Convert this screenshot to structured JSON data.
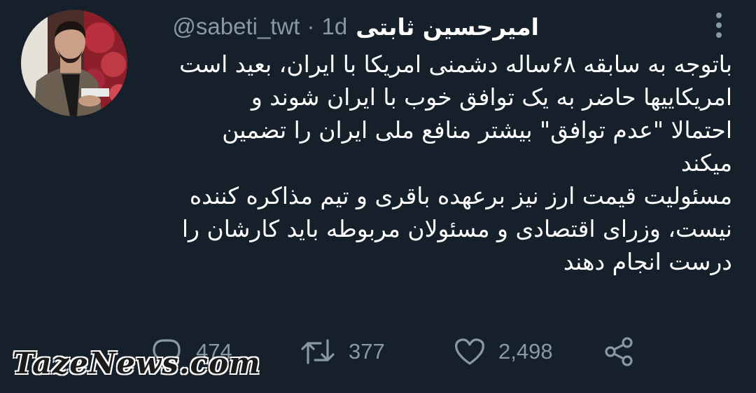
{
  "tweet": {
    "author_name": "امیرحسین ثابتی",
    "handle": "@sabeti_twt",
    "separator": "·",
    "time": "1d",
    "lines": [
      "باتوجه به سابقه ۶۸ساله دشمنی امریکا با ایران، بعید است",
      "امریکاییها حاضر به یک توافق خوب با ایران شوند و",
      "احتمالا \"عدم توافق\" بیشتر منافع ملی ایران را تضمین",
      "میکند",
      "مسئولیت قیمت ارز نیز برعهده باقری و تیم مذاکره کننده",
      "نیست، وزرای اقتصادی و مسئولان مربوطه باید کارشان را",
      "درست انجام دهند"
    ]
  },
  "actions": {
    "reply_count": "474",
    "retweet_count": "377",
    "like_count": "2,498"
  },
  "icons": {
    "reply": "reply-icon",
    "retweet": "retweet-icon",
    "like": "heart-icon",
    "share": "share-icon",
    "more": "more-vertical-icon"
  },
  "watermark": "TazeNews.com",
  "colors": {
    "background": "#15202b",
    "text": "#ffffff",
    "secondary": "#8899a6"
  }
}
